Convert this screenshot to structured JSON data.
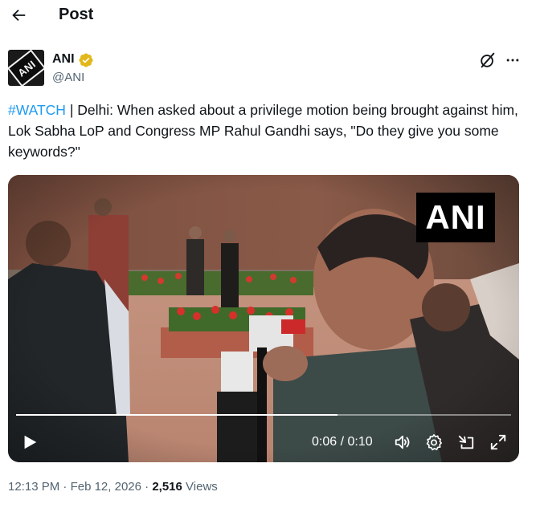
{
  "header": {
    "title": "Post"
  },
  "author": {
    "name": "ANI",
    "handle": "@ANI",
    "avatar_text": "ANI",
    "verified_color": "#e2b719"
  },
  "tweet": {
    "hashtag": "#WATCH",
    "separator": " | ",
    "body": "Delhi: When asked about a privilege motion being brought against him, Lok Sabha LoP and Congress MP Rahul Gandhi says, \"Do they give you some keywords?\""
  },
  "video": {
    "watermark": "ANI",
    "current_time": "0:06",
    "duration": "0:10",
    "time_display": "0:06 / 0:10",
    "progress_fraction": 0.65
  },
  "meta": {
    "time": "12:13 PM",
    "date": "Feb 12, 2026",
    "views_count": "2,516",
    "views_label": "Views"
  },
  "colors": {
    "accent": "#1d9bf0",
    "muted": "#536471",
    "text": "#0f1419"
  }
}
